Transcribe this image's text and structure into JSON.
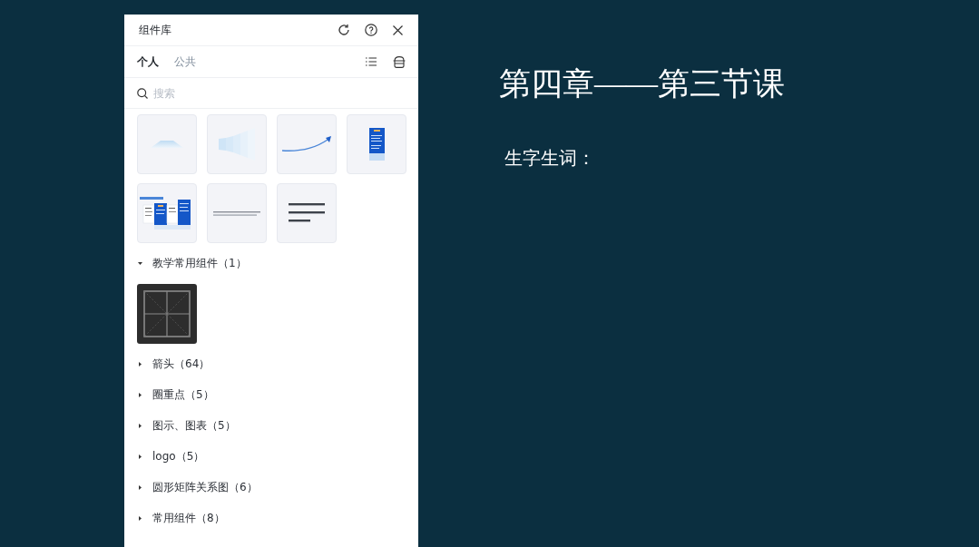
{
  "panel": {
    "title": "组件库",
    "tabs": [
      {
        "label": "个人",
        "selected": true
      },
      {
        "label": "公共",
        "selected": false
      }
    ],
    "search": {
      "placeholder": "搜索"
    },
    "thumbnails": [
      {
        "kind": "mound"
      },
      {
        "kind": "funnel"
      },
      {
        "kind": "curve"
      },
      {
        "kind": "phone"
      },
      {
        "kind": "cards"
      },
      {
        "kind": "textline"
      },
      {
        "kind": "paragraph"
      }
    ],
    "categories": [
      {
        "label": "教学常用组件（1）",
        "expanded": true,
        "items": [
          {
            "kind": "grid"
          }
        ]
      },
      {
        "label": "箭头（64）",
        "expanded": false
      },
      {
        "label": "圈重点（5）",
        "expanded": false
      },
      {
        "label": "图示、图表（5）",
        "expanded": false
      },
      {
        "label": "logo（5）",
        "expanded": false
      },
      {
        "label": "圆形矩阵关系图（6）",
        "expanded": false
      },
      {
        "label": "常用组件（8）",
        "expanded": false
      }
    ]
  },
  "slide": {
    "title": "第四章——第三节课",
    "subtitle": "生字生词："
  }
}
